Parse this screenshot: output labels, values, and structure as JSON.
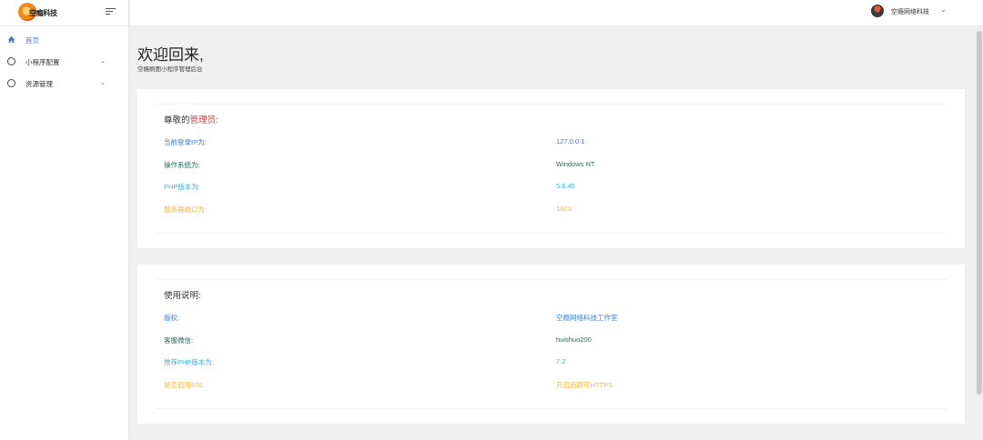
{
  "sidebar": {
    "logo_text": "空瘾科技",
    "items": [
      {
        "label": "首页",
        "icon": "home-icon",
        "active": true
      },
      {
        "label": "小程序配置",
        "icon": "circle-icon",
        "arrow": "⌄"
      },
      {
        "label": "资源管理",
        "icon": "circle-icon",
        "arrow": "⌄"
      }
    ]
  },
  "header": {
    "user_name": "空瘾网络科技",
    "dropdown_arrow": "⌄"
  },
  "welcome": {
    "title": "欢迎回来,",
    "subtitle": "空瘾刷图小程序管理后台"
  },
  "info_card": {
    "heading_prefix": "尊敬的",
    "heading_highlight": "管理员",
    "heading_suffix": ":",
    "rows": [
      {
        "key": "当前登录IP为:",
        "value": "127.0.0.1"
      },
      {
        "key": "操作系统为:",
        "value": "Windows NT"
      },
      {
        "key": "PHP版本为:",
        "value": "5.6.40"
      },
      {
        "key": "服务器端口为:",
        "value": "1023"
      }
    ]
  },
  "usage_card": {
    "heading": "使用说明:",
    "rows": [
      {
        "key": "版权:",
        "value": "空瘾网络科技工作室"
      },
      {
        "key": "客服微信:",
        "value": "huishuo200"
      },
      {
        "key": "推荐PHP版本为:",
        "value": "7.2"
      },
      {
        "key": "是否启用SSL:",
        "value": "开启后即可HTTPS"
      }
    ]
  },
  "colors": {
    "blue": "#3b7ddd",
    "green": "#2d6a5a",
    "cyan": "#3bb4e0",
    "orange": "#f5b642",
    "highlight_red": "#e53935"
  }
}
